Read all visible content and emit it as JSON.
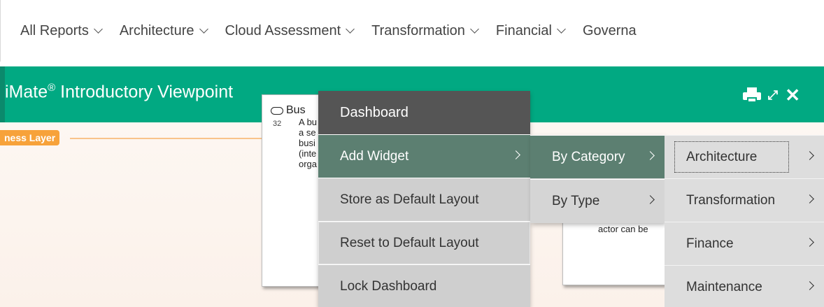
{
  "nav": {
    "items": [
      {
        "label": "All Reports"
      },
      {
        "label": "Architecture"
      },
      {
        "label": "Cloud Assessment"
      },
      {
        "label": "Transformation"
      },
      {
        "label": "Financial"
      },
      {
        "label": "Governa"
      }
    ]
  },
  "panel": {
    "title": "iMate",
    "title_sup": "®",
    "title_rest": " Introductory Viewpoint",
    "layer_tag": "ness Layer",
    "colors": {
      "header": "#01a982",
      "tag": "#f7a23a",
      "menu_active": "#5c7f71",
      "menu_header": "#555555"
    }
  },
  "cards": [
    {
      "title": "Bus",
      "number": "32",
      "lines": [
        "A bu",
        "a se",
        "busi",
        "(inte",
        "orga"
      ]
    },
    {
      "text": "actor can be"
    }
  ],
  "menu": {
    "header": "Dashboard",
    "items": [
      {
        "label": "Add Widget"
      },
      {
        "label": "Store as Default Layout"
      },
      {
        "label": "Reset to Default Layout"
      },
      {
        "label": "Lock Dashboard"
      }
    ],
    "submenu": [
      {
        "label": "By Category"
      },
      {
        "label": "By Type"
      }
    ],
    "categories": [
      {
        "label": "Architecture"
      },
      {
        "label": "Transformation"
      },
      {
        "label": "Finance"
      },
      {
        "label": "Maintenance"
      }
    ]
  },
  "icons": [
    "print-icon",
    "expand-icon",
    "close-icon",
    "chevron-down-icon",
    "chevron-right-icon"
  ]
}
